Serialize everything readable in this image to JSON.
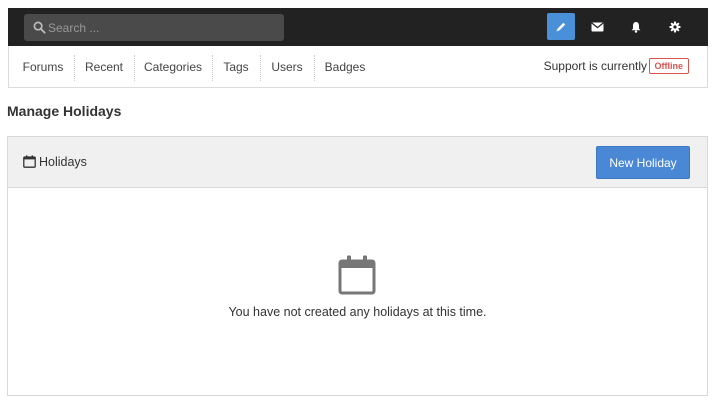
{
  "search": {
    "placeholder": "Search ..."
  },
  "toolbar": {
    "icons": [
      "pencil-icon",
      "envelope-icon",
      "bell-icon",
      "gear-icon"
    ],
    "accent": "#4a90d9",
    "background": "#222222"
  },
  "nav": {
    "items": [
      {
        "label": "Forums"
      },
      {
        "label": "Recent"
      },
      {
        "label": "Categories"
      },
      {
        "label": "Tags"
      },
      {
        "label": "Users"
      },
      {
        "label": "Badges"
      }
    ],
    "support_text": "Support is currently",
    "status_badge": "Offline",
    "status_color": "#d9534f"
  },
  "page": {
    "title": "Manage Holidays"
  },
  "panel": {
    "title": "Holidays",
    "title_icon": "calendar-icon",
    "new_button": "New Holiday",
    "button_color": "#4a87d4",
    "empty_icon": "calendar-icon",
    "empty_message": "You have not created any holidays at this time."
  }
}
